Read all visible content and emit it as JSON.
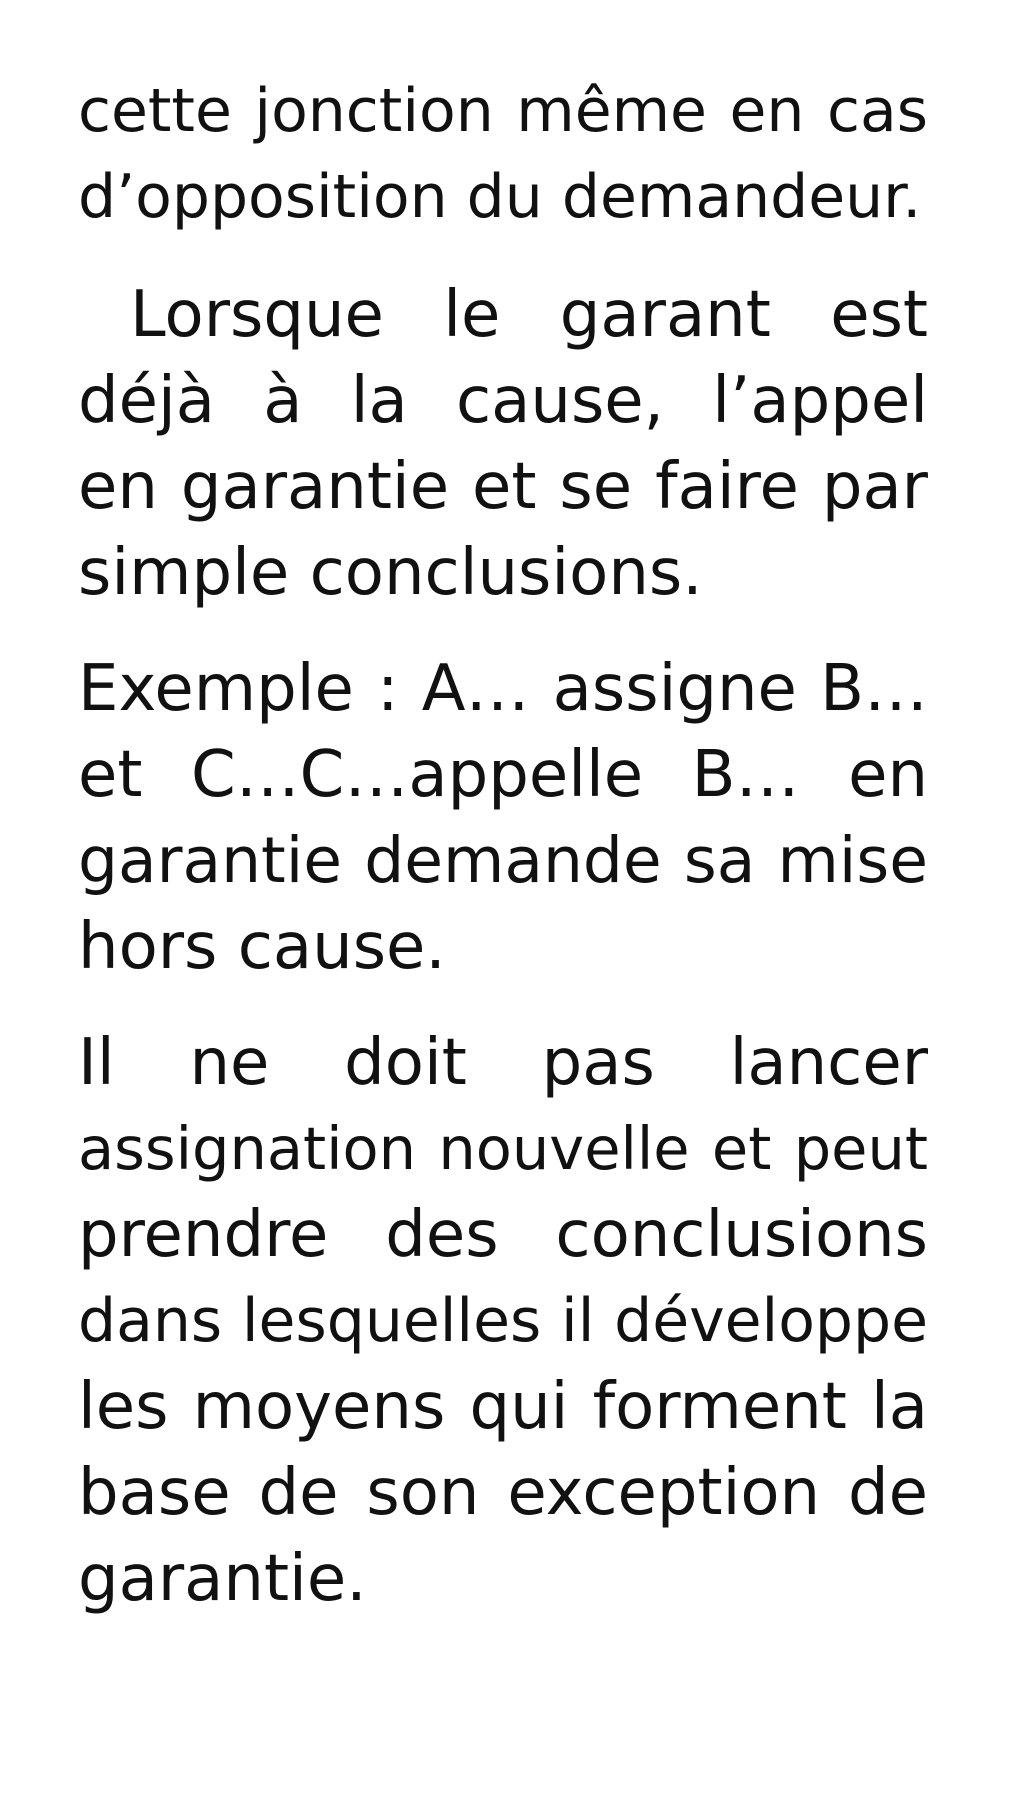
{
  "document": {
    "paragraphs": [
      {
        "lines": [
          "cette jonction même en cas",
          "d’opposition du demandeur."
        ]
      },
      {
        "lines": [
          "Lorsque le garant est",
          "déjà à la cause, l’appel",
          "en garantie et se faire par",
          "simple conclusions."
        ]
      },
      {
        "lines": [
          "Exemple : A… assigne B…",
          "et C…C…appelle B… en",
          "garantie demande sa mise",
          "hors cause."
        ]
      },
      {
        "lines": [
          "Il ne doit pas lancer",
          "assignation nouvelle et peut",
          "prendre des conclusions",
          "dans lesquelles il développe",
          "les moyens qui forment la",
          "base de son exception de",
          "garantie."
        ]
      }
    ]
  }
}
